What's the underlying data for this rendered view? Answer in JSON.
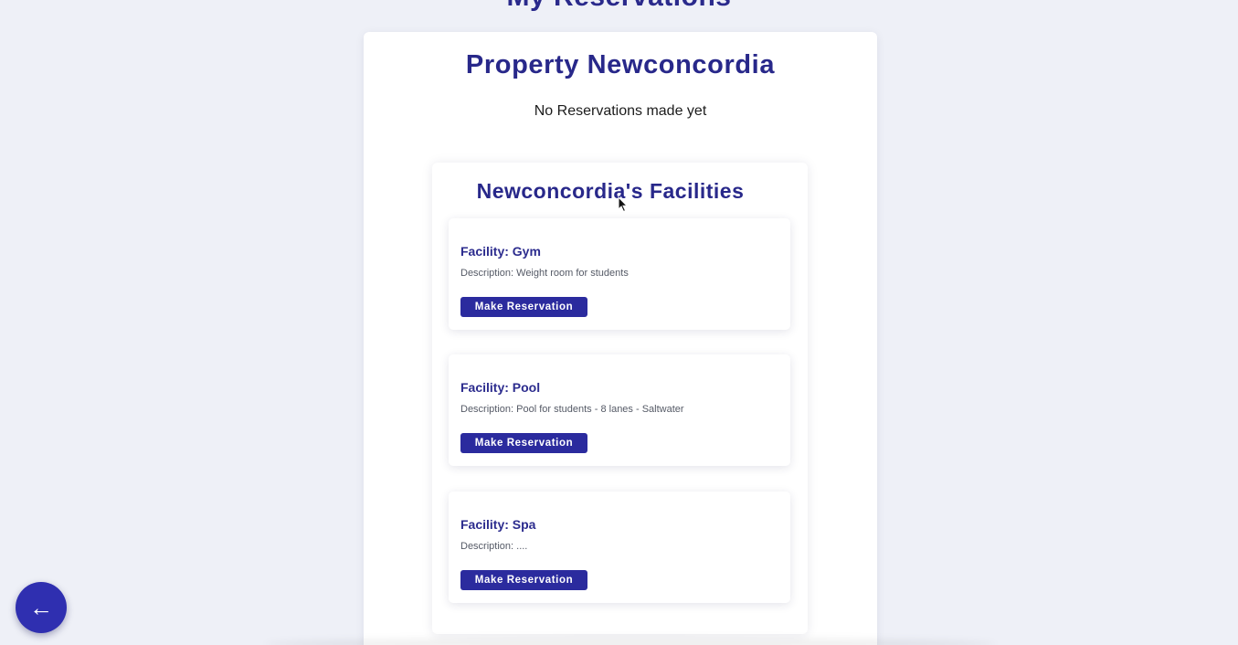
{
  "header": {
    "title": "My Reservations"
  },
  "property": {
    "title": "Property Newconcordia",
    "empty_message": "No Reservations made yet"
  },
  "facilities": {
    "title": "Newconcordia's Facilities",
    "items": [
      {
        "name": "Facility: Gym",
        "description": "Description: Weight room for students",
        "button_label": "Make Reservation"
      },
      {
        "name": "Facility: Pool",
        "description": "Description: Pool for students - 8 lanes - Saltwater",
        "button_label": "Make Reservation"
      },
      {
        "name": "Facility: Spa",
        "description": "Description: ....",
        "button_label": "Make Reservation"
      }
    ]
  },
  "back_button": {
    "icon": "arrow-left-icon",
    "glyph": "←"
  },
  "colors": {
    "background": "#eef0f7",
    "heading": "#28288a",
    "button": "#2b2b9e",
    "back_button": "#2f2fb0"
  }
}
